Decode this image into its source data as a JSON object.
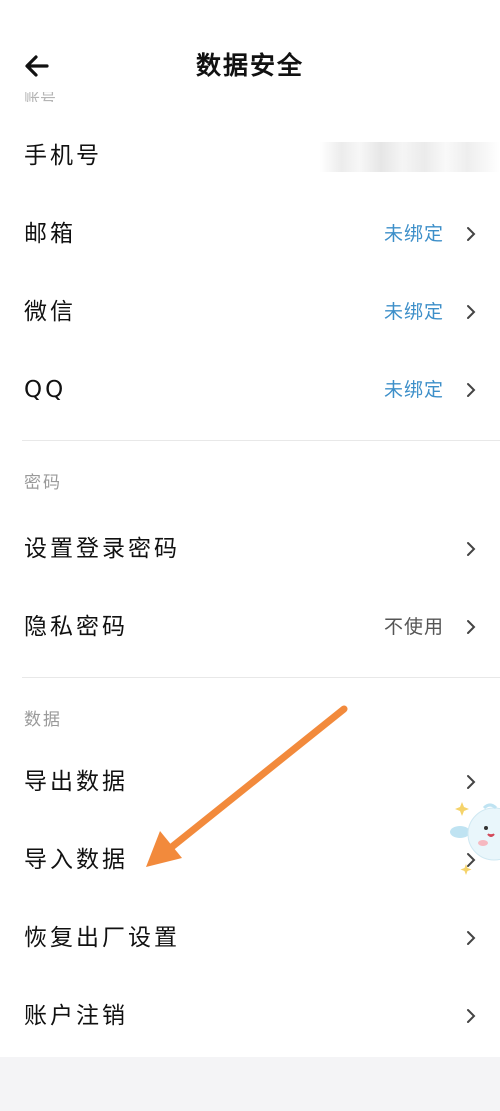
{
  "header": {
    "title": "数据安全",
    "back_icon": "arrow-left-icon",
    "cut_label": "账号"
  },
  "account": {
    "rows": [
      {
        "label": "手机号",
        "value": "",
        "value_blurred": true
      },
      {
        "label": "邮箱",
        "value": "未绑定"
      },
      {
        "label": "微信",
        "value": "未绑定"
      },
      {
        "label": "QQ",
        "value": "未绑定"
      }
    ]
  },
  "password": {
    "section_title": "密码",
    "rows": [
      {
        "label": "设置登录密码",
        "value": ""
      },
      {
        "label": "隐私密码",
        "value": "不使用"
      }
    ]
  },
  "data": {
    "section_title": "数据",
    "rows": [
      {
        "label": "导出数据"
      },
      {
        "label": "导入数据"
      },
      {
        "label": "恢复出厂设置"
      },
      {
        "label": "账户注销"
      }
    ]
  },
  "colors": {
    "accent_blue": "#3d8fc9",
    "annotation_arrow": "#f28a3c",
    "section_title_gray": "#9a9a9a"
  },
  "icons": {
    "chevron": "chevron-right-icon",
    "mascot": "mascot-sticker-icon"
  }
}
